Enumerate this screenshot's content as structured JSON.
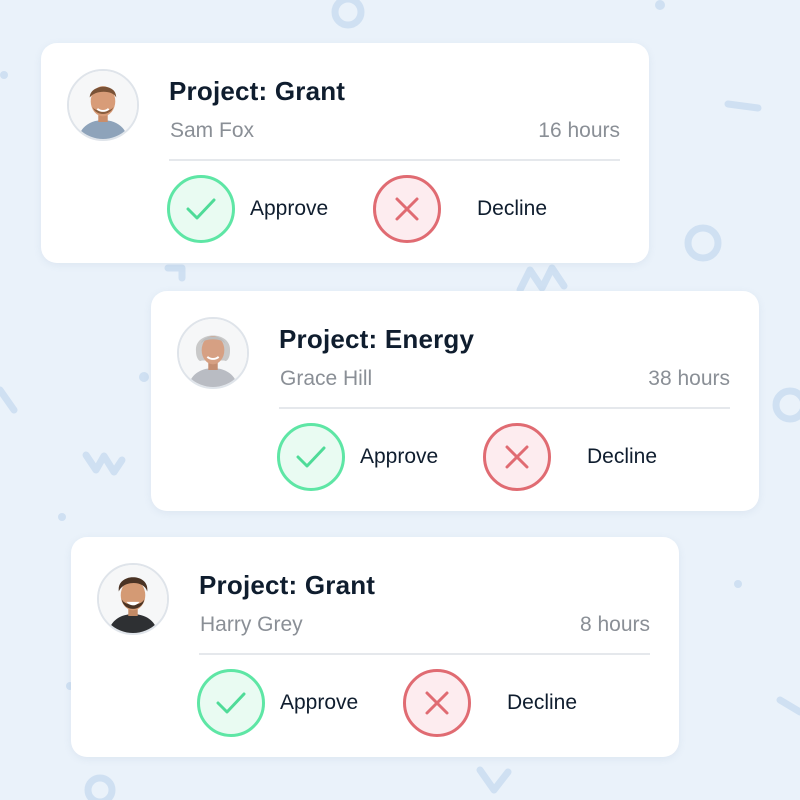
{
  "colors": {
    "background": "#eaf2fa",
    "card": "#ffffff",
    "title_text": "#0f1d2e",
    "secondary_text": "#8a8f96",
    "approve_accent": "#5ee6a5",
    "decline_accent": "#e06b72"
  },
  "cards": [
    {
      "title": "Project: Grant",
      "person": "Sam Fox",
      "hours": "16 hours",
      "approve_label": "Approve",
      "decline_label": "Decline",
      "avatar_icon": "man-avatar"
    },
    {
      "title": "Project: Energy",
      "person": "Grace Hill",
      "hours": "38 hours",
      "approve_label": "Approve",
      "decline_label": "Decline",
      "avatar_icon": "woman-avatar"
    },
    {
      "title": "Project: Grant",
      "person": "Harry Grey",
      "hours": "8 hours",
      "approve_label": "Approve",
      "decline_label": "Decline",
      "avatar_icon": "man-avatar"
    }
  ]
}
